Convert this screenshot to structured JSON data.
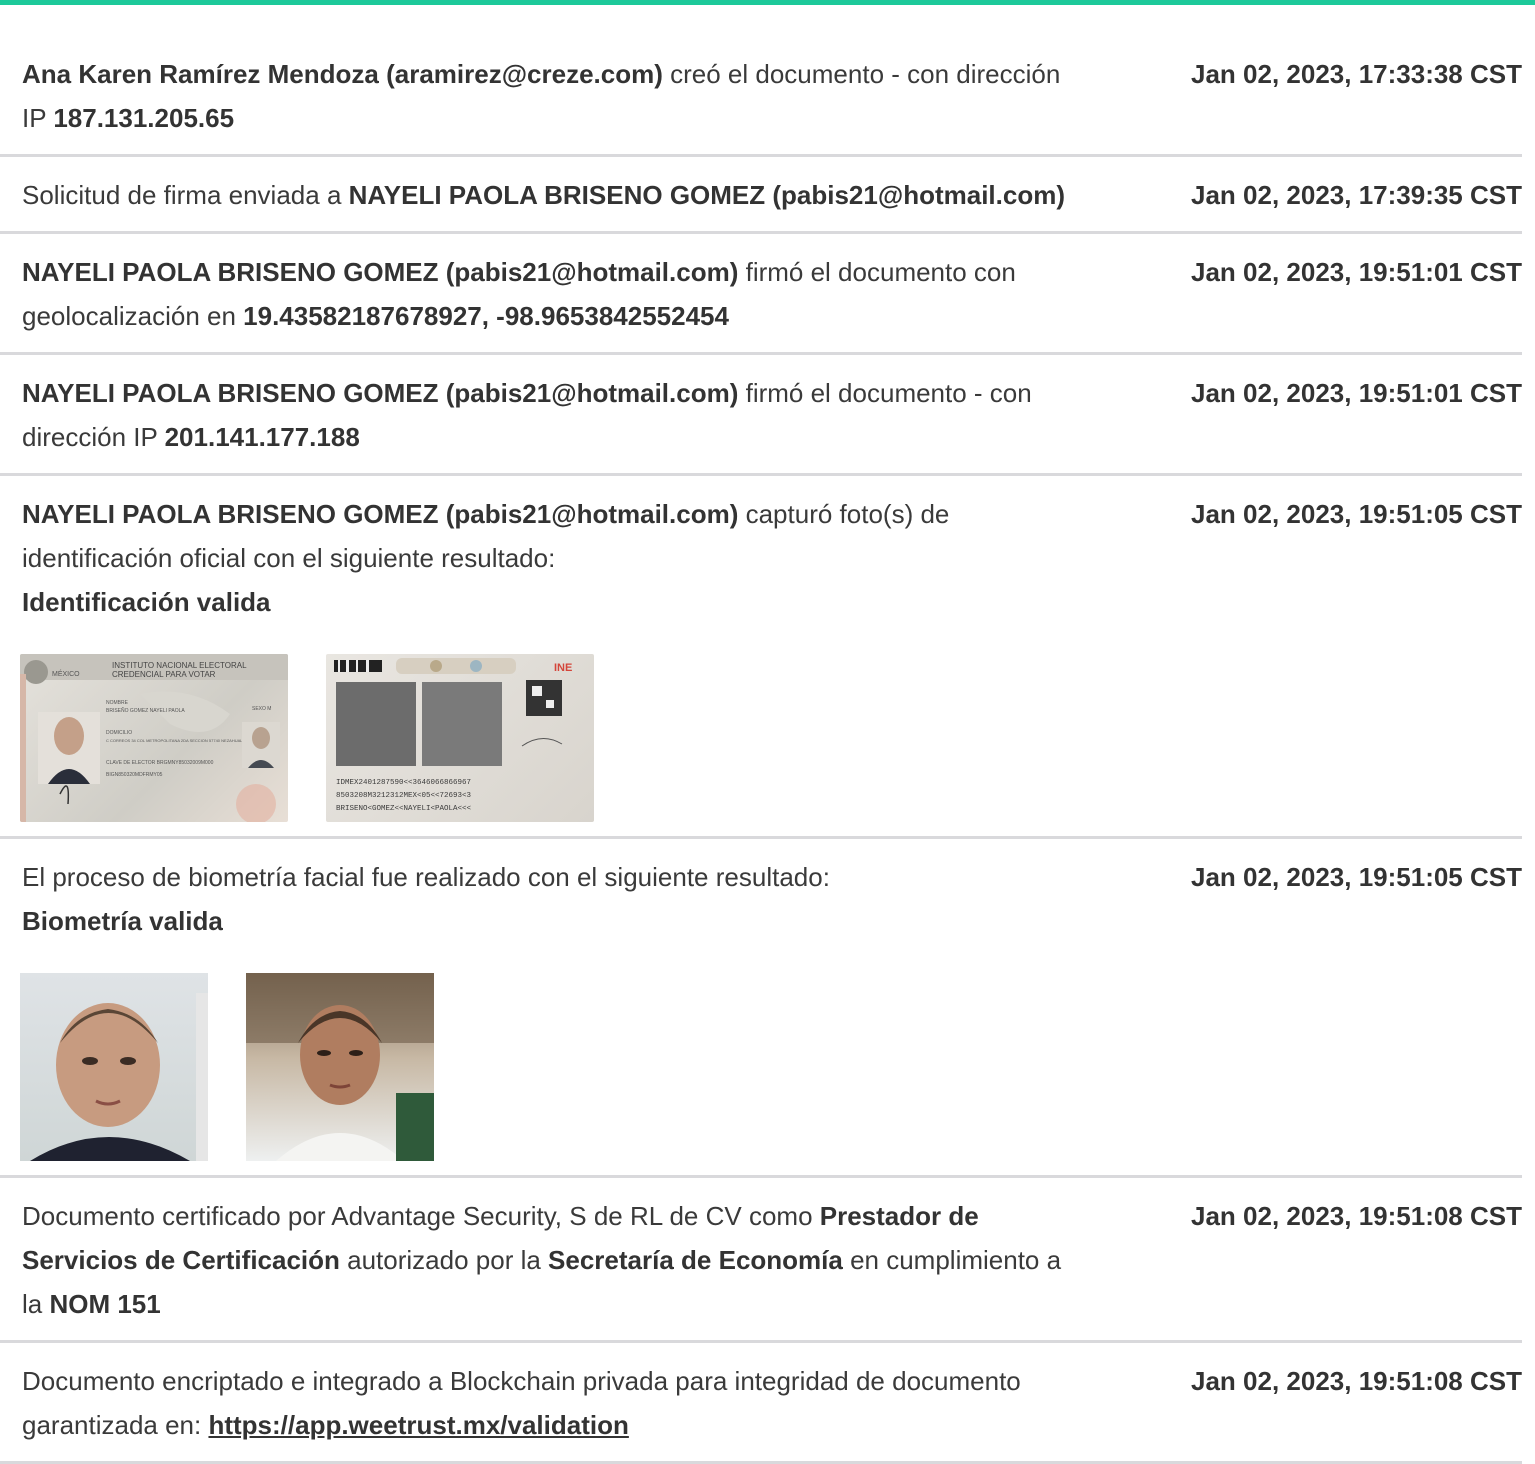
{
  "accent": "#1dc99a",
  "entries": [
    {
      "parts": [
        {
          "t": "Ana Karen Ramírez Mendoza (aramirez@creze.com)",
          "b": true
        },
        {
          "t": " creó el documento - con dirección IP "
        },
        {
          "t": "187.131.205.65",
          "b": true
        }
      ],
      "timestamp": "Jan 02, 2023, 17:33:38 CST"
    },
    {
      "parts": [
        {
          "t": "Solicitud de firma enviada a "
        },
        {
          "t": "NAYELI PAOLA BRISENO GOMEZ (pabis21@hotmail.com)",
          "b": true
        }
      ],
      "timestamp": "Jan 02, 2023, 17:39:35 CST"
    },
    {
      "parts": [
        {
          "t": "NAYELI PAOLA BRISENO GOMEZ (pabis21@hotmail.com)",
          "b": true
        },
        {
          "t": " firmó el documento con geolocalización en "
        },
        {
          "t": "19.43582187678927, -98.9653842552454",
          "b": true
        }
      ],
      "timestamp": "Jan 02, 2023, 19:51:01 CST"
    },
    {
      "parts": [
        {
          "t": "NAYELI PAOLA BRISENO GOMEZ (pabis21@hotmail.com)",
          "b": true
        },
        {
          "t": " firmó el documento - con dirección IP "
        },
        {
          "t": "201.141.177.188",
          "b": true
        }
      ],
      "timestamp": "Jan 02, 2023, 19:51:01 CST"
    },
    {
      "parts": [
        {
          "t": "NAYELI PAOLA BRISENO GOMEZ (pabis21@hotmail.com)",
          "b": true
        },
        {
          "t": " capturó foto(s) de identificación oficial con el siguiente resultado:"
        },
        {
          "t": "Identificación valida",
          "b": true,
          "br": true
        }
      ],
      "timestamp": "Jan 02, 2023, 19:51:05 CST",
      "images": "id"
    },
    {
      "parts": [
        {
          "t": "El proceso de biometría facial fue realizado con el siguiente resultado:"
        },
        {
          "t": "Biometría valida",
          "b": true,
          "br": true
        }
      ],
      "timestamp": "Jan 02, 2023, 19:51:05 CST",
      "images": "face"
    },
    {
      "parts": [
        {
          "t": "Documento certificado por Advantage Security, S de RL de CV como "
        },
        {
          "t": "Prestador de Servicios de Certificación",
          "b": true
        },
        {
          "t": " autorizado por la "
        },
        {
          "t": "Secretaría de Economía",
          "b": true
        },
        {
          "t": " en cumplimiento a la "
        },
        {
          "t": "NOM 151",
          "b": true
        }
      ],
      "timestamp": "Jan 02, 2023, 19:51:08 CST"
    },
    {
      "parts": [
        {
          "t": "Documento encriptado e integrado a Blockchain privada para integridad de documento garantizada en: "
        },
        {
          "t": "https://app.weetrust.mx/validation",
          "link": true
        }
      ],
      "timestamp": "Jan 02, 2023, 19:51:08 CST"
    }
  ],
  "id_card": {
    "front": {
      "country": "MÉXICO",
      "line1": "INSTITUTO NACIONAL ELECTORAL",
      "line2": "CREDENCIAL PARA VOTAR",
      "name_label": "NOMBRE",
      "name": "BRISEÑO GOMEZ NAYELI PAOLA",
      "sex": "SEXO M",
      "address_label": "DOMICILIO",
      "address": "C CORREOS 34 COL METROPOLITANA 2DA SECCION 57740 NEZAHUALCOYOTL, MEX",
      "elector": "CLAVE DE ELECTOR BRGMNY85032009M000",
      "curp": "BIGN850320MDFRMY05"
    },
    "back": {
      "brand": "INE",
      "mrz1": "IDMEX2401287590<<3646066866967",
      "mrz2": "8503208M3212312MEX<05<<72693<3",
      "mrz3": "BRISENO<GOMEZ<<NAYELI<PAOLA<<<"
    }
  }
}
